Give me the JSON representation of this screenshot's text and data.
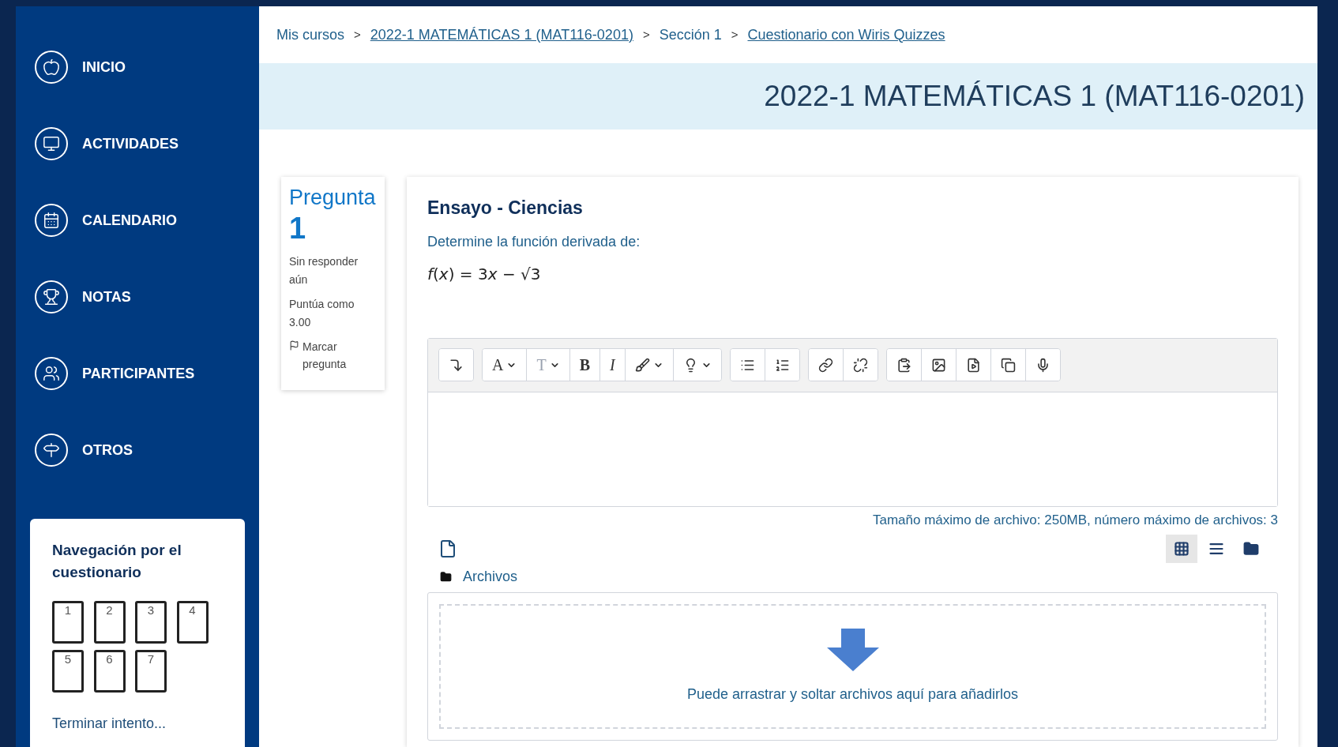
{
  "sidebar": {
    "items": [
      {
        "kind": "home",
        "label": "INICIO"
      },
      {
        "kind": "activities",
        "label": "ACTIVIDADES"
      },
      {
        "kind": "calendar",
        "label": "CALENDARIO"
      },
      {
        "kind": "grades",
        "label": "NOTAS"
      },
      {
        "kind": "participants",
        "label": "PARTICIPANTES"
      },
      {
        "kind": "others",
        "label": "OTROS"
      }
    ]
  },
  "quiz_navigation": {
    "title": "Navegación por el cuestionario",
    "questions": [
      "1",
      "2",
      "3",
      "4",
      "5",
      "6",
      "7"
    ],
    "finish_link": "Terminar intento..."
  },
  "breadcrumb": [
    {
      "label": "Mis cursos",
      "link": false
    },
    {
      "label": "2022-1 MATEMÁTICAS 1 (MAT116-0201)",
      "link": true
    },
    {
      "label": "Sección 1",
      "link": false
    },
    {
      "label": "Cuestionario con Wiris Quizzes",
      "link": true
    }
  ],
  "breadcrumb_separator": ">",
  "page_header": "2022-1 MATEMÁTICAS 1 (MAT116-0201)",
  "question_info": {
    "label": "Pregunta",
    "number": "1",
    "status": "Sin responder aún",
    "grade": "Puntúa como 3.00",
    "flag_link": "Marcar pregunta"
  },
  "question": {
    "title": "Ensayo - Ciencias",
    "prompt": "Determine la función derivada de:",
    "formula": [
      {
        "text": "f",
        "italic": true
      },
      {
        "text": "(",
        "italic": false
      },
      {
        "text": "x",
        "italic": true
      },
      {
        "text": ") = 3",
        "italic": false
      },
      {
        "text": "x",
        "italic": true
      },
      {
        "text": " − √3",
        "italic": false
      }
    ]
  },
  "editor_toolbar": [
    [
      {
        "kind": "collapse"
      }
    ],
    [
      {
        "kind": "font-color",
        "label": "A"
      },
      {
        "kind": "styles",
        "label": "T"
      },
      {
        "kind": "bold",
        "label": "B"
      },
      {
        "kind": "italic",
        "label": "I"
      },
      {
        "kind": "brush"
      },
      {
        "kind": "bulb"
      }
    ],
    [
      {
        "kind": "bullets"
      },
      {
        "kind": "numbers"
      }
    ],
    [
      {
        "kind": "link"
      },
      {
        "kind": "unlink"
      }
    ],
    [
      {
        "kind": "paste"
      },
      {
        "kind": "image"
      },
      {
        "kind": "media"
      },
      {
        "kind": "copy"
      },
      {
        "kind": "mic"
      }
    ]
  ],
  "file_limits": "Tamaño máximo de archivo: 250MB, número máximo de archivos: 3",
  "file_views": [
    {
      "kind": "grid",
      "selected": true
    },
    {
      "kind": "list",
      "selected": false
    },
    {
      "kind": "tree",
      "selected": false
    }
  ],
  "files_folder": "Archivos",
  "dropzone_hint": "Puede arrastrar y soltar archivos aquí para añadirlos"
}
